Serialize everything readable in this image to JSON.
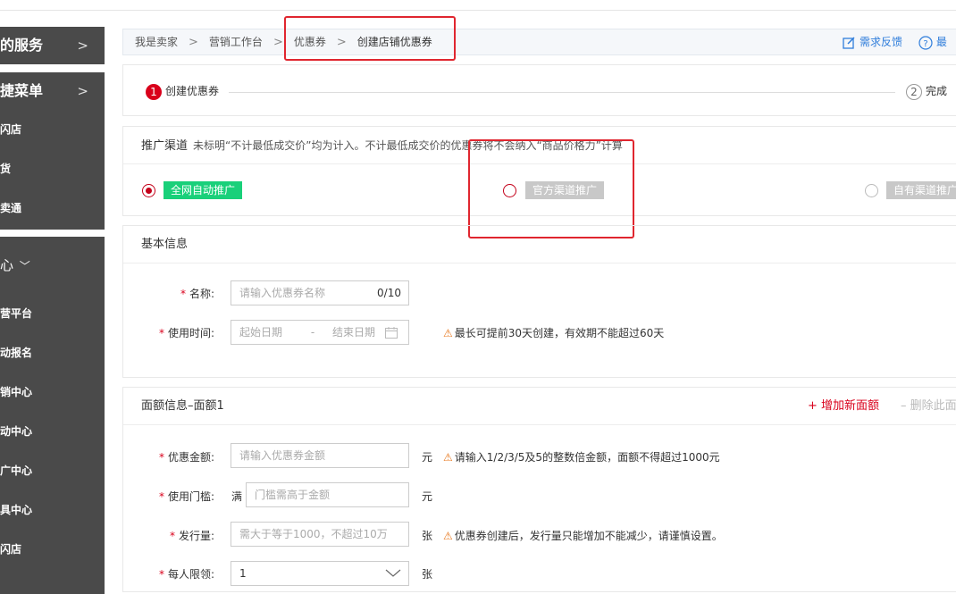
{
  "sidebar": {
    "head1": "的服务",
    "head2": "捷菜单",
    "quick_items": [
      "闪店",
      "货",
      "卖通"
    ],
    "section": "心",
    "items": [
      "营平台",
      "动报名",
      "销中心",
      "动中心",
      "广中心",
      "具中心",
      "闪店"
    ]
  },
  "breadcrumb": {
    "items": [
      "我是卖家",
      "营销工作台",
      "优惠券"
    ],
    "current": "创建店铺优惠券",
    "feedback": "需求反馈",
    "help": "最"
  },
  "steps": {
    "step1_num": "1",
    "step1": "创建优惠券",
    "step2_num": "2",
    "step2": "完成"
  },
  "channel": {
    "title": "推广渠道",
    "note": "未标明“不计最低成交价”均为计入。不计最低成交价的优惠券将不会纳入“商品价格力”计算",
    "options": [
      "全网自动推广",
      "官方渠道推广",
      "自有渠道推广"
    ]
  },
  "basic": {
    "title": "基本信息",
    "name_label": "名称:",
    "name_placeholder": "请输入优惠券名称",
    "name_counter": "0/10",
    "time_label": "使用时间:",
    "start_placeholder": "起始日期",
    "date_sep": "-",
    "end_placeholder": "结束日期",
    "time_hint": "最长可提前30天创建，有效期不能超过60天"
  },
  "face": {
    "title": "面额信息–面额1",
    "add": "+ 增加新面额",
    "delete": "– 删除此面",
    "amount_label": "优惠金额:",
    "amount_placeholder": "请输入优惠券金额",
    "amount_unit": "元",
    "amount_hint": "请输入1/2/3/5及5的整数倍金额，面额不得超过1000元",
    "threshold_label": "使用门槛:",
    "threshold_prefix": "满",
    "threshold_placeholder": "门槛需高于金额",
    "threshold_unit": "元",
    "issue_label": "发行量:",
    "issue_placeholder": "需大于等于1000，不超过10万",
    "issue_unit": "张",
    "issue_hint": "优惠券创建后，发行量只能增加不能减少，请谨慎设置。",
    "limit_label": "每人限领:",
    "limit_value": "1",
    "limit_unit": "张"
  },
  "colors": {
    "accent_red": "#d9001b",
    "green_tag": "#19d07a",
    "disabled_tag": "#c8c8c8",
    "link_blue": "#2f7ddb",
    "sidebar_bg": "#4a4a4a"
  }
}
